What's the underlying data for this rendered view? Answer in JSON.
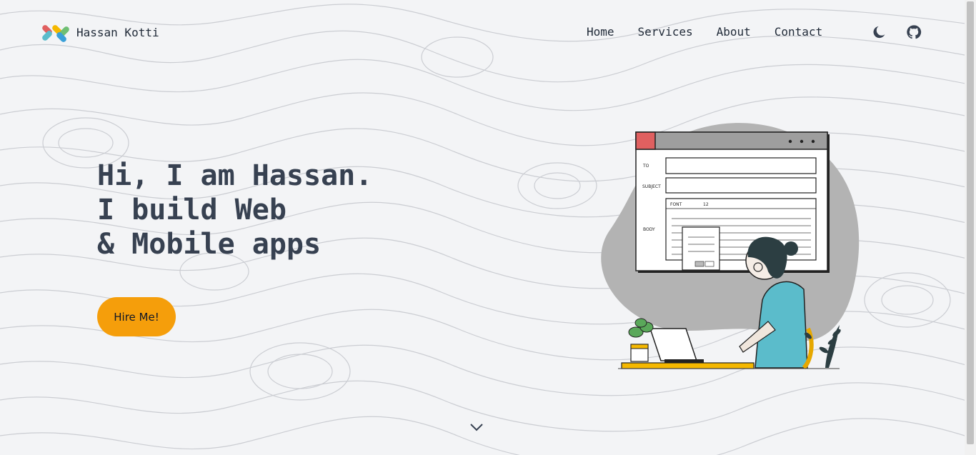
{
  "brand": {
    "name": "Hassan Kotti",
    "logo_icon": "code-logo-icon"
  },
  "nav": {
    "links": [
      "Home",
      "Services",
      "About",
      "Contact"
    ]
  },
  "icons": {
    "theme_toggle": "moon-icon",
    "github": "github-icon",
    "scroll_down": "chevron-down-icon"
  },
  "hero": {
    "line1": "Hi, I am Hassan.",
    "line2": "I build Web",
    "line3": "& Mobile apps",
    "cta_label": "Hire Me!"
  },
  "illustration": {
    "to_label": "TO",
    "subject_label": "SUBJECT",
    "body_label": "BODY",
    "font_label": "FONT",
    "size_label": "12"
  },
  "colors": {
    "accent": "#f59e0b",
    "text": "#374151",
    "background": "#f3f4f6",
    "illus_teal": "#5bbccb",
    "illus_red": "#e06060"
  }
}
